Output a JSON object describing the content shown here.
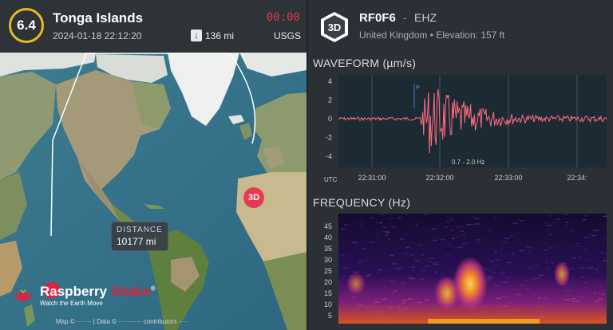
{
  "event": {
    "magnitude": "6.4",
    "location": "Tonga Islands",
    "datetime": "2024-01-18 22:12:20",
    "countdown": "00:00",
    "depth": "136 mi",
    "source": "USGS"
  },
  "map": {
    "distance_label": "DISTANCE",
    "distance_value": "10177 mi",
    "station_marker": "3D",
    "logo_name_part1": "Raspberry ",
    "logo_name_part2": "Shake",
    "logo_registered": "®",
    "logo_tagline": "Watch the Earth Move",
    "attribution": "Map © ······· | Data © ··········· contributors ····"
  },
  "station": {
    "badge": "3D",
    "id": "RF0F6",
    "separator": "-",
    "channel": "EHZ",
    "info": "United Kingdom • Elevation: 157 ft"
  },
  "waveform": {
    "title": "WAVEFORM (µm/s)",
    "y_ticks": [
      "4",
      "2",
      "0",
      "-2",
      "-4"
    ],
    "x_ticks": [
      "22:31:00",
      "22:32:00",
      "22:33:00",
      "22:34:"
    ],
    "x_prefix": "UTC",
    "filter_label": "0.7 - 2.0 Hz",
    "p_marker": "P",
    "line_color": "#ff6b81"
  },
  "frequency": {
    "title": "FREQUENCY (Hz)",
    "y_ticks": [
      "45",
      "40",
      "35",
      "30",
      "25",
      "20",
      "15",
      "10",
      "5"
    ]
  }
}
